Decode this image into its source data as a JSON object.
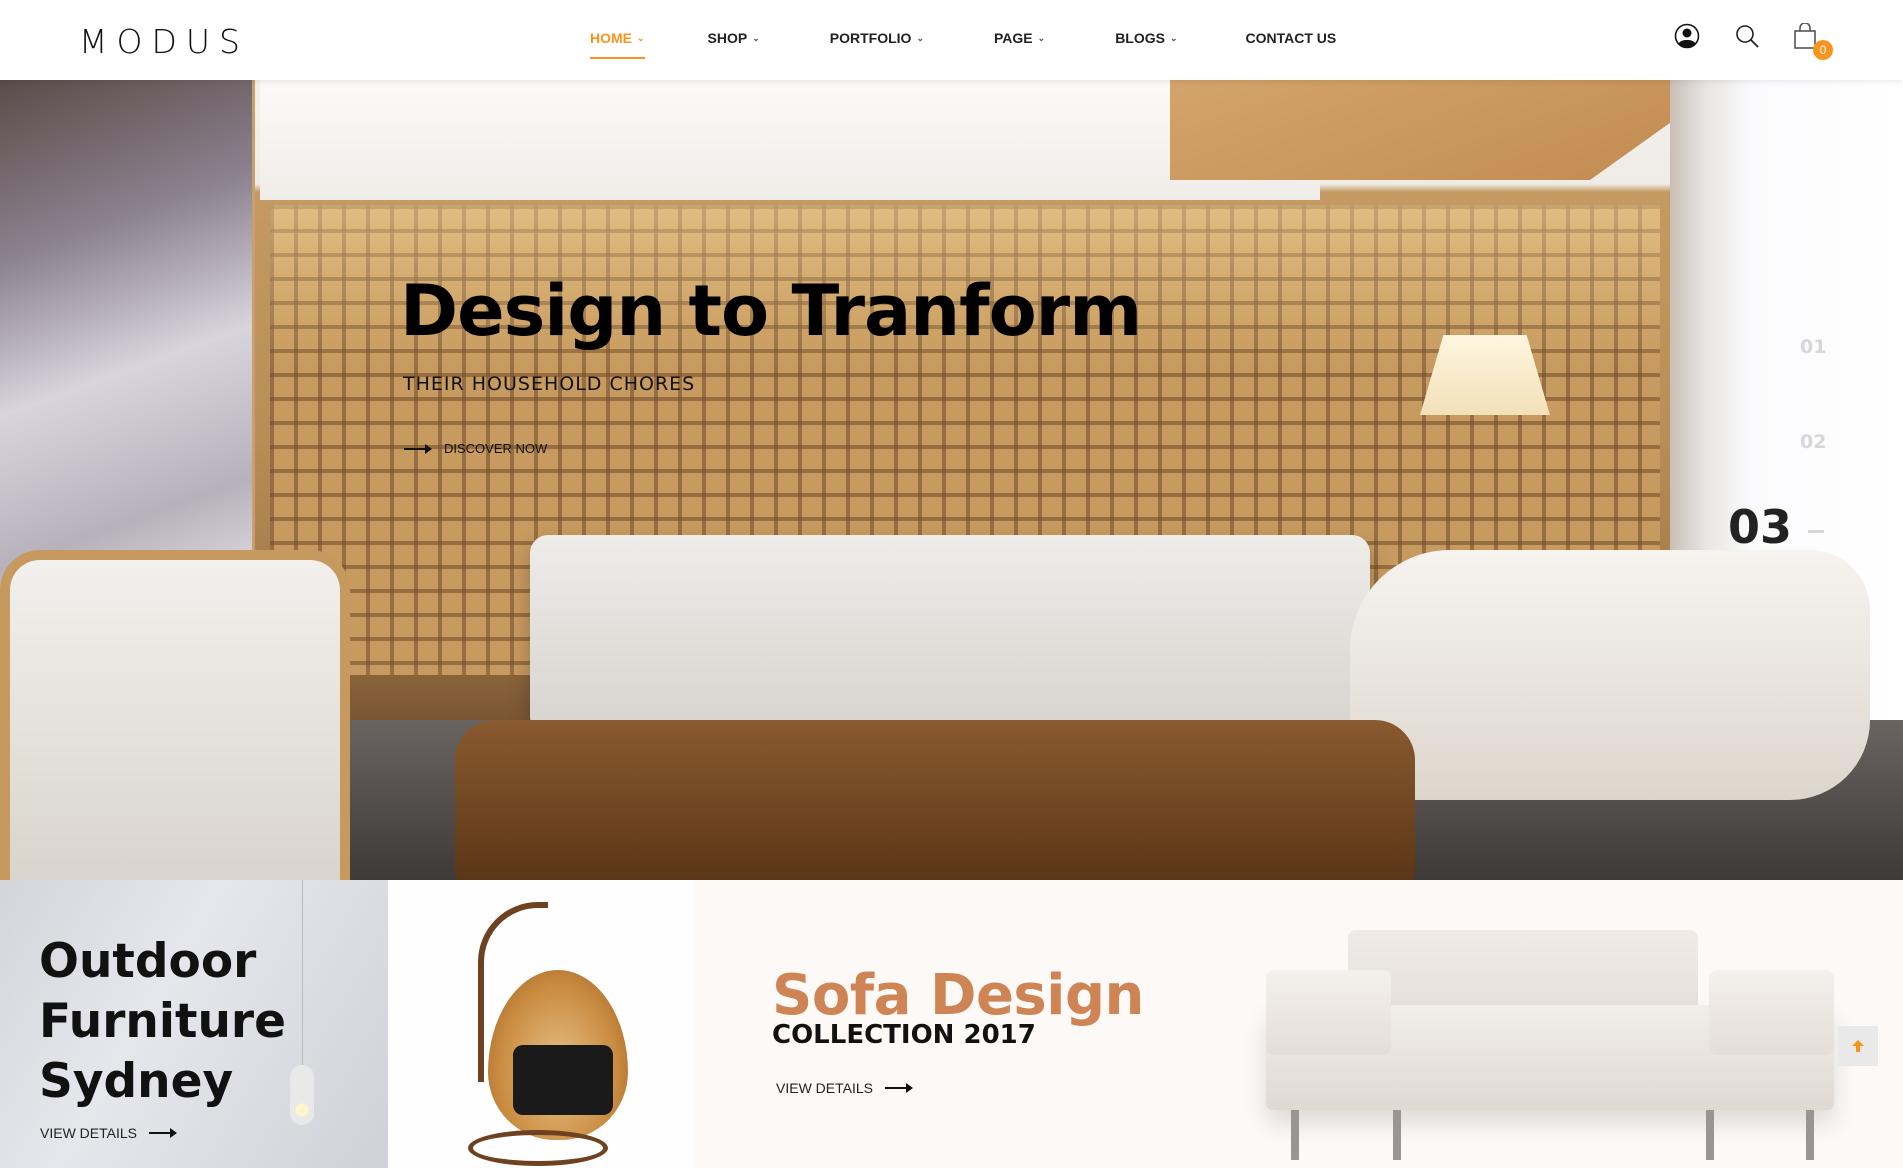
{
  "header": {
    "logo": "MODUS",
    "nav": [
      {
        "label": "HOME",
        "has_dropdown": true,
        "active": true
      },
      {
        "label": "SHOP",
        "has_dropdown": true,
        "active": false
      },
      {
        "label": "PORTFOLIO",
        "has_dropdown": true,
        "active": false
      },
      {
        "label": "PAGE",
        "has_dropdown": true,
        "active": false
      },
      {
        "label": "BLOGS",
        "has_dropdown": true,
        "active": false
      },
      {
        "label": "CONTACT US",
        "has_dropdown": false,
        "active": false
      }
    ],
    "icons": [
      "user-icon",
      "search-icon",
      "cart-icon"
    ],
    "cart_count": "0",
    "accent_color": "#f7941d"
  },
  "hero": {
    "title": "Design to Tranform",
    "subtitle": "THEIR HOUSEHOLD CHORES",
    "cta_label": "DISCOVER NOW",
    "slides": [
      "01",
      "02",
      "03"
    ],
    "active_slide": "03"
  },
  "banners": [
    {
      "title_lines": [
        "Outdoor",
        "Furniture",
        "Sydney"
      ],
      "cta_label": "VIEW DETAILS"
    },
    {
      "title": "Sofa Design",
      "subtitle": "COLLECTION 2017",
      "cta_label": "VIEW DETAILS",
      "title_color": "#cf8456"
    }
  ],
  "scroll_top": {
    "icon": "arrow-up-icon"
  }
}
